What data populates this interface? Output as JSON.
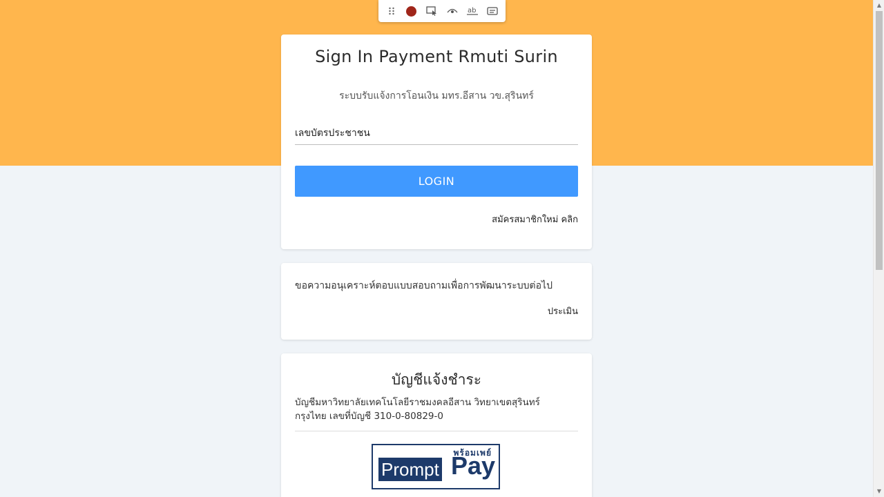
{
  "login": {
    "title": "Sign In Payment Rmuti Surin",
    "subtitle": "ระบบรับแจ้งการโอนเงิน มทร.อีสาน วข.สุรินทร์",
    "id_placeholder": "เลขบัตรประชาชน",
    "login_label": "LOGIN",
    "register_label": "สมัครสมาชิกใหม่ คลิก"
  },
  "survey": {
    "text": "ขอความอนุเคราะห์ตอบแบบสอบถามเพื่อการพัฒนาระบบต่อไป",
    "link_label": "ประเมิน"
  },
  "account": {
    "title": "บัญชีแจ้งชำระ",
    "line1": "บัญชีมหาวิทยาลัยเทคโนโลยีราชมงคลอีสาน วิทยาเขตสุรินทร์",
    "line2": "กรุงไทย เลขที่บัญชี 310-0-80829-0",
    "logo": {
      "thai": "พร้อมเพย์",
      "prompt": "Prompt",
      "pay": "Pay"
    }
  },
  "toolbar": {
    "icons": [
      "drag-handle-icon",
      "record-icon",
      "select-element-icon",
      "eye-icon",
      "text-icon",
      "caption-icon"
    ]
  },
  "colors": {
    "header_band": "#ffb64d",
    "login_button": "#4099ff",
    "page_background": "#f0f4f8",
    "promptpay_blue": "#1d3a6a"
  }
}
